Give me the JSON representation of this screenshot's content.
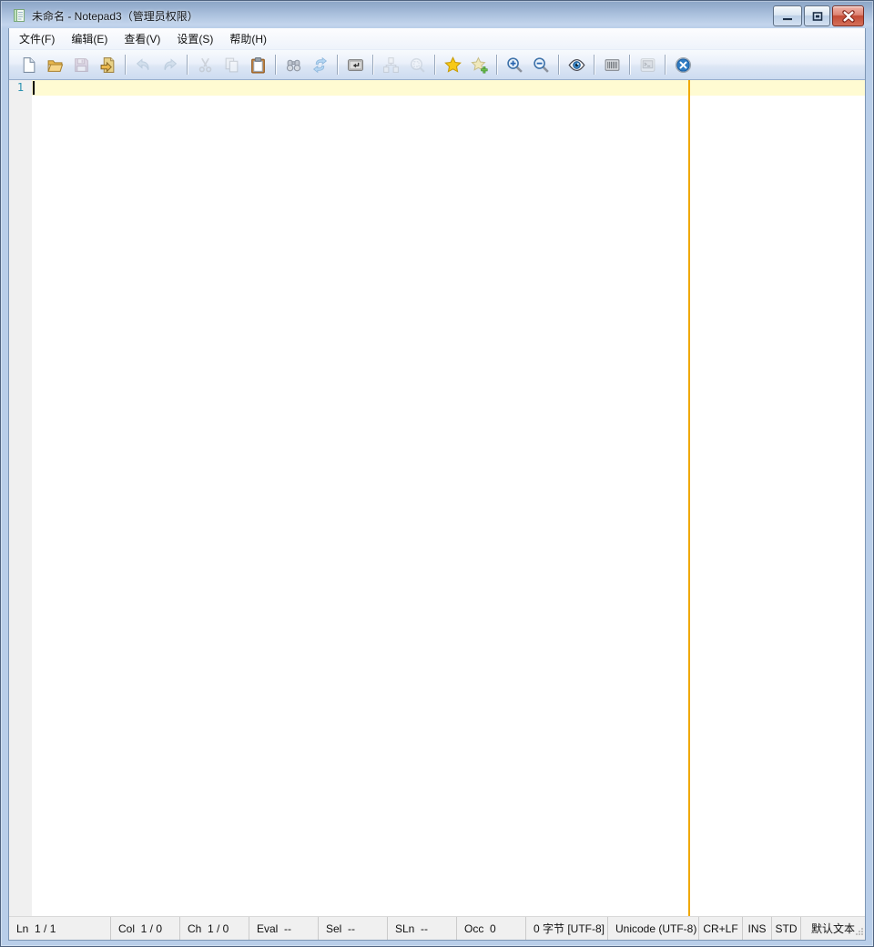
{
  "window": {
    "title": "未命名 - Notepad3（管理员权限）",
    "controls": [
      {
        "name": "minimize"
      },
      {
        "name": "restore"
      },
      {
        "name": "close"
      }
    ]
  },
  "menu_bar": {
    "items": [
      {
        "name": "file",
        "label": "文件(F)"
      },
      {
        "name": "edit",
        "label": "编辑(E)"
      },
      {
        "name": "view",
        "label": "查看(V)"
      },
      {
        "name": "settings",
        "label": "设置(S)"
      },
      {
        "name": "help",
        "label": "帮助(H)"
      }
    ]
  },
  "toolbar": {
    "groups": [
      [
        {
          "name": "new-file",
          "disabled": false
        },
        {
          "name": "open-file",
          "disabled": false
        },
        {
          "name": "save",
          "disabled": true
        },
        {
          "name": "browse",
          "disabled": false
        }
      ],
      [
        {
          "name": "undo",
          "disabled": true
        },
        {
          "name": "redo",
          "disabled": true
        }
      ],
      [
        {
          "name": "cut",
          "disabled": true
        },
        {
          "name": "copy",
          "disabled": true
        },
        {
          "name": "paste",
          "disabled": false
        }
      ],
      [
        {
          "name": "find",
          "disabled": false
        },
        {
          "name": "replace",
          "disabled": false
        }
      ],
      [
        {
          "name": "word-wrap",
          "disabled": false
        }
      ],
      [
        {
          "name": "code-structure",
          "disabled": true
        },
        {
          "name": "zoom-select",
          "disabled": true
        }
      ],
      [
        {
          "name": "favorites",
          "disabled": false
        },
        {
          "name": "add-favorite",
          "disabled": false
        }
      ],
      [
        {
          "name": "zoom-in",
          "disabled": false
        },
        {
          "name": "zoom-out",
          "disabled": false
        }
      ],
      [
        {
          "name": "view-eye",
          "disabled": false
        }
      ],
      [
        {
          "name": "grid",
          "disabled": false
        }
      ],
      [
        {
          "name": "console",
          "disabled": true
        }
      ],
      [
        {
          "name": "exit",
          "disabled": false
        }
      ]
    ]
  },
  "editor": {
    "line_number": "1",
    "text": "",
    "current_line_color": "#fffbd2",
    "long_line_marker_color": "#f0a800",
    "line_number_color": "#2b91af"
  },
  "status_bar": {
    "cells": [
      {
        "name": "line",
        "text": "Ln  1 / 1"
      },
      {
        "name": "column",
        "text": "Col  1 / 0"
      },
      {
        "name": "character",
        "text": "Ch  1 / 0"
      },
      {
        "name": "eval",
        "text": "Eval  --"
      },
      {
        "name": "selection",
        "text": "Sel  --"
      },
      {
        "name": "selected-lines",
        "text": "SLn  --"
      },
      {
        "name": "occurrences",
        "text": "Occ  0"
      },
      {
        "name": "size",
        "text": "0 字节 [UTF-8]"
      },
      {
        "name": "encoding",
        "text": "Unicode (UTF-8)"
      },
      {
        "name": "eol",
        "text": "CR+LF"
      },
      {
        "name": "overtype",
        "text": "INS"
      },
      {
        "name": "case",
        "text": "STD"
      },
      {
        "name": "scheme",
        "text": "默认文本"
      }
    ]
  }
}
